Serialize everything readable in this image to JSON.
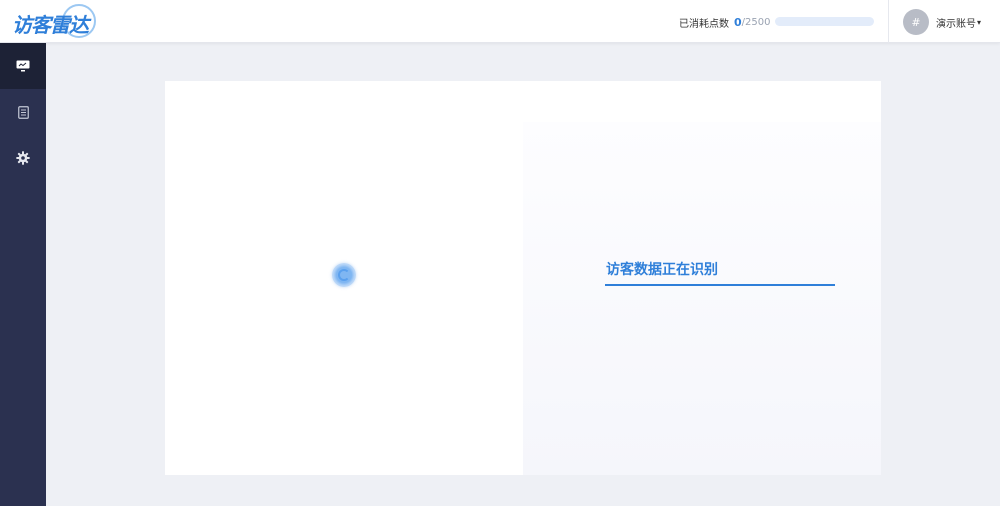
{
  "header": {
    "logo_text": "访客雷达",
    "points_label": "已消耗点数",
    "points_used": "0",
    "points_total": "/2500",
    "points_progress_fraction": 0,
    "avatar_glyph": "#",
    "account_name": "演示账号",
    "caret": "▾"
  },
  "sidebar": {
    "items": [
      {
        "icon": "monitor-icon",
        "active": true
      },
      {
        "icon": "document-icon",
        "active": false
      },
      {
        "icon": "gear-icon",
        "active": false
      }
    ]
  },
  "main": {
    "status_text": "访客数据正在识别"
  },
  "colors": {
    "accent": "#2f7fd9",
    "sidebar_bg": "#2b3150",
    "sidebar_active_bg": "#1d2236",
    "page_bg": "#eef0f5"
  }
}
